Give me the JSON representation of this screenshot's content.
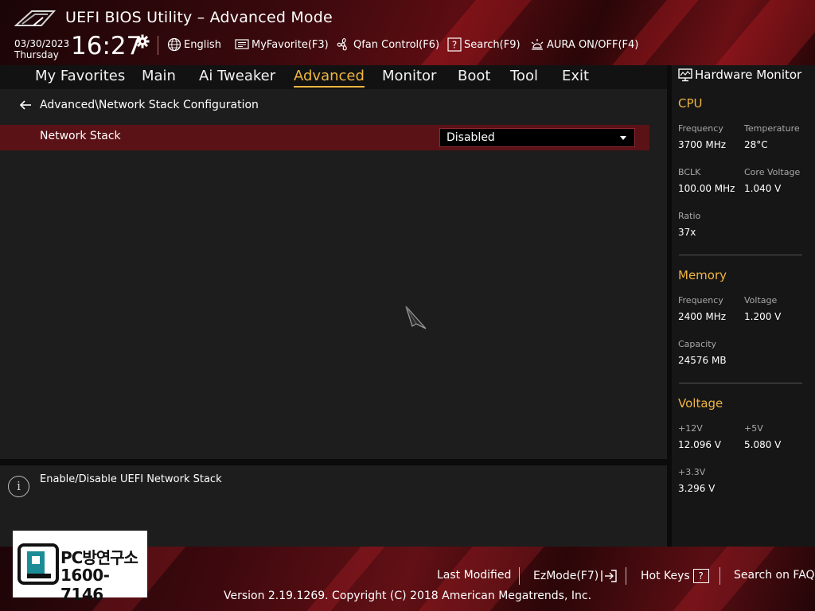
{
  "header": {
    "title": "UEFI BIOS Utility – Advanced Mode",
    "date": "03/30/2023",
    "weekday": "Thursday",
    "time": "16:27",
    "toolbar": {
      "language": "English",
      "myfavorite": "MyFavorite(F3)",
      "qfan": "Qfan Control(F6)",
      "search": "Search(F9)",
      "aura": "AURA ON/OFF(F4)"
    }
  },
  "menu": {
    "items": [
      "My Favorites",
      "Main",
      "Ai Tweaker",
      "Advanced",
      "Monitor",
      "Boot",
      "Tool",
      "Exit"
    ],
    "active": "Advanced"
  },
  "main": {
    "breadcrumb": "Advanced\\Network Stack Configuration",
    "settings": [
      {
        "label": "Network Stack",
        "value": "Disabled",
        "selected": true
      }
    ]
  },
  "help": {
    "text": "Enable/Disable UEFI Network Stack"
  },
  "hwmon": {
    "title": "Hardware Monitor",
    "cpu": {
      "heading": "CPU",
      "frequency_label": "Frequency",
      "frequency": "3700 MHz",
      "temperature_label": "Temperature",
      "temperature": "28°C",
      "bclk_label": "BCLK",
      "bclk": "100.00 MHz",
      "core_voltage_label": "Core Voltage",
      "core_voltage": "1.040 V",
      "ratio_label": "Ratio",
      "ratio": "37x"
    },
    "memory": {
      "heading": "Memory",
      "frequency_label": "Frequency",
      "frequency": "2400 MHz",
      "voltage_label": "Voltage",
      "voltage": "1.200 V",
      "capacity_label": "Capacity",
      "capacity": "24576 MB"
    },
    "voltage": {
      "heading": "Voltage",
      "v12_label": "+12V",
      "v12": "12.096 V",
      "v5_label": "+5V",
      "v5": "5.080 V",
      "v33_label": "+3.3V",
      "v33": "3.296 V"
    }
  },
  "footer": {
    "last_modified": "Last Modified",
    "ezmode": "EzMode(F7)",
    "hotkeys": "Hot Keys",
    "hotkeys_key": "?",
    "search_faq": "Search on FAQ",
    "copyright": "Version 2.19.1269. Copyright (C) 2018 American Megatrends, Inc."
  },
  "watermark": {
    "line1": "PC방연구소",
    "line2": "1600-7146"
  },
  "colors": {
    "accent": "#f0b542",
    "row_highlight": "#5b1216",
    "header_red": "#5c0d12"
  },
  "icons": [
    "rog-logo-icon",
    "gear-icon",
    "globe-icon",
    "myfavorite-icon",
    "fan-icon",
    "search-icon",
    "aura-icon",
    "back-arrow-icon",
    "dropdown-caret-icon",
    "info-icon",
    "monitor-icon",
    "ezmode-exit-icon",
    "help-key-icon",
    "mouse-cursor-icon"
  ]
}
